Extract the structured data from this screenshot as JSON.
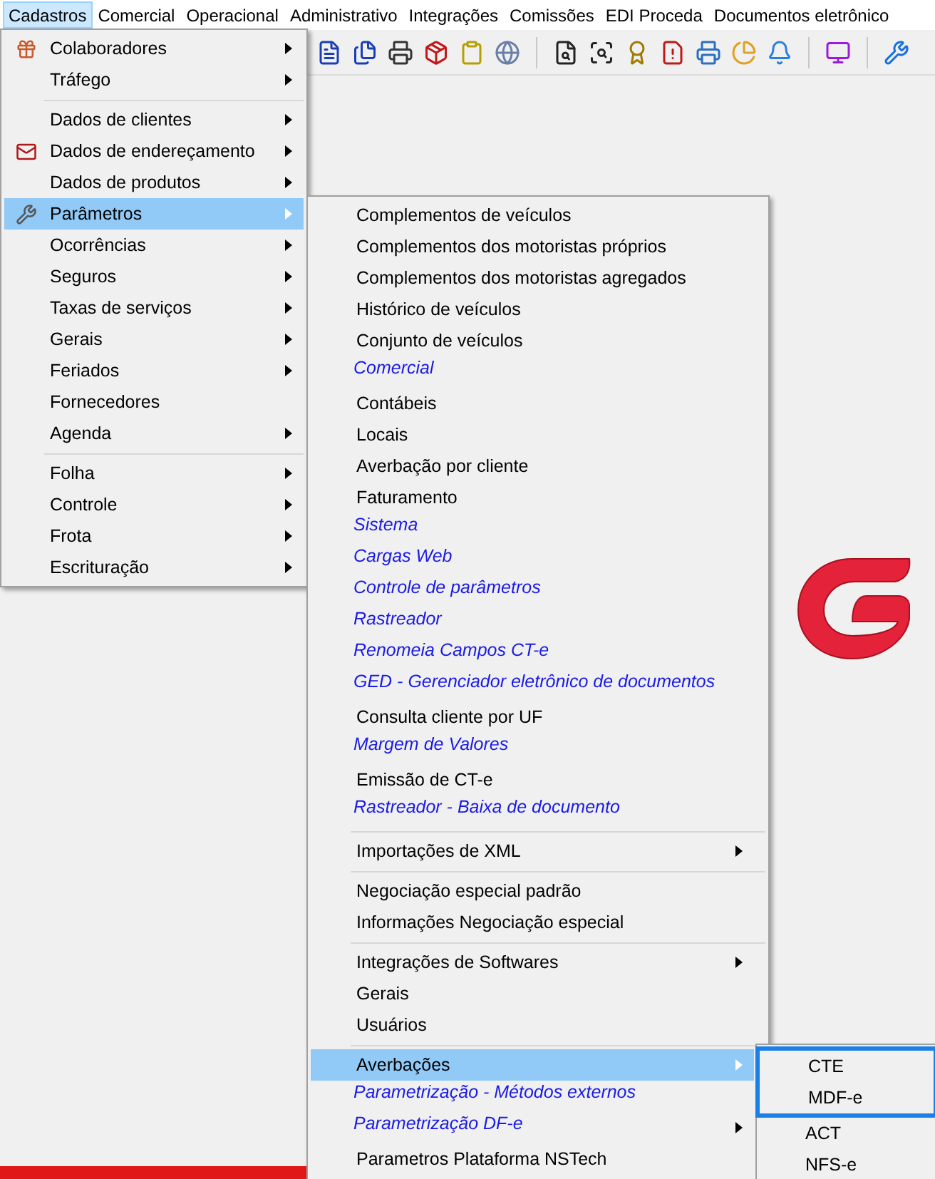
{
  "menubar": [
    {
      "label": "Cadastros",
      "selected": true
    },
    {
      "label": "Comercial",
      "selected": false
    },
    {
      "label": "Operacional",
      "selected": false
    },
    {
      "label": "Administrativo",
      "selected": false
    },
    {
      "label": "Integrações",
      "selected": false
    },
    {
      "label": "Comissões",
      "selected": false
    },
    {
      "label": "EDI Proceda",
      "selected": false
    },
    {
      "label": "Documentos eletrônico",
      "selected": false
    }
  ],
  "menu": {
    "items": [
      {
        "kind": "item",
        "label": "Colaboradores",
        "submenu": true,
        "selected": false
      },
      {
        "kind": "item",
        "label": "Tráfego",
        "submenu": true,
        "selected": false
      },
      {
        "kind": "separator"
      },
      {
        "kind": "item",
        "label": "Dados de clientes",
        "submenu": true,
        "selected": false
      },
      {
        "kind": "item",
        "label": "Dados de endereçamento",
        "submenu": true,
        "selected": false
      },
      {
        "kind": "item",
        "label": "Dados de produtos",
        "submenu": true,
        "selected": false
      },
      {
        "kind": "item",
        "label": "Parâmetros",
        "submenu": true,
        "selected": true
      },
      {
        "kind": "item",
        "label": "Ocorrências",
        "submenu": true,
        "selected": false
      },
      {
        "kind": "item",
        "label": "Seguros",
        "submenu": true,
        "selected": false
      },
      {
        "kind": "item",
        "label": "Taxas de serviços",
        "submenu": true,
        "selected": false
      },
      {
        "kind": "item",
        "label": "Gerais",
        "submenu": true,
        "selected": false
      },
      {
        "kind": "item",
        "label": "Feriados",
        "submenu": true,
        "selected": false
      },
      {
        "kind": "item",
        "label": "Fornecedores",
        "submenu": false,
        "selected": false
      },
      {
        "kind": "item",
        "label": "Agenda",
        "submenu": true,
        "selected": false
      },
      {
        "kind": "separator"
      },
      {
        "kind": "item",
        "label": "Folha",
        "submenu": true,
        "selected": false
      },
      {
        "kind": "item",
        "label": "Controle",
        "submenu": true,
        "selected": false
      },
      {
        "kind": "item",
        "label": "Frota",
        "submenu": true,
        "selected": false
      },
      {
        "kind": "item",
        "label": "Escrituração",
        "submenu": true,
        "selected": false
      }
    ]
  },
  "submenu": {
    "items": [
      {
        "kind": "item",
        "label": "Complementos de veículos",
        "submenu": false,
        "selected": false
      },
      {
        "kind": "item",
        "label": "Complementos dos motoristas próprios",
        "submenu": false,
        "selected": false
      },
      {
        "kind": "item",
        "label": "Complementos dos motoristas agregados",
        "submenu": false,
        "selected": false
      },
      {
        "kind": "item",
        "label": "Histórico de veículos",
        "submenu": false,
        "selected": false
      },
      {
        "kind": "item",
        "label": "Conjunto de veículos",
        "submenu": false,
        "selected": false
      },
      {
        "kind": "link",
        "label": "Comercial",
        "submenu": false,
        "selected": false
      },
      {
        "kind": "item",
        "label": "Contábeis",
        "submenu": false,
        "selected": false
      },
      {
        "kind": "item",
        "label": "Locais",
        "submenu": false,
        "selected": false
      },
      {
        "kind": "item",
        "label": "Averbação por cliente",
        "submenu": false,
        "selected": false
      },
      {
        "kind": "item",
        "label": "Faturamento",
        "submenu": false,
        "selected": false
      },
      {
        "kind": "link",
        "label": "Sistema",
        "submenu": false,
        "selected": false
      },
      {
        "kind": "link",
        "label": "Cargas Web",
        "submenu": false,
        "selected": false
      },
      {
        "kind": "link",
        "label": "Controle de parâmetros",
        "submenu": false,
        "selected": false
      },
      {
        "kind": "link",
        "label": "Rastreador",
        "submenu": false,
        "selected": false
      },
      {
        "kind": "link",
        "label": "Renomeia Campos CT-e",
        "submenu": false,
        "selected": false
      },
      {
        "kind": "link",
        "label": "GED - Gerenciador eletrônico de documentos",
        "submenu": false,
        "selected": false
      },
      {
        "kind": "item",
        "label": "Consulta cliente por UF",
        "submenu": false,
        "selected": false
      },
      {
        "kind": "link",
        "label": "Margem de Valores",
        "submenu": false,
        "selected": false
      },
      {
        "kind": "item",
        "label": "Emissão de CT-e",
        "submenu": false,
        "selected": false
      },
      {
        "kind": "link",
        "label": "Rastreador - Baixa de documento",
        "submenu": false,
        "selected": false
      },
      {
        "kind": "separator"
      },
      {
        "kind": "item",
        "label": "Importações de XML",
        "submenu": true,
        "selected": false
      },
      {
        "kind": "separator"
      },
      {
        "kind": "item",
        "label": "Negociação especial padrão",
        "submenu": false,
        "selected": false
      },
      {
        "kind": "item",
        "label": "Informações Negociação especial",
        "submenu": false,
        "selected": false
      },
      {
        "kind": "separator"
      },
      {
        "kind": "item",
        "label": "Integrações de Softwares",
        "submenu": true,
        "selected": false
      },
      {
        "kind": "item",
        "label": "Gerais",
        "submenu": false,
        "selected": false
      },
      {
        "kind": "item",
        "label": "Usuários",
        "submenu": false,
        "selected": false
      },
      {
        "kind": "separator"
      },
      {
        "kind": "item",
        "label": "Averbações",
        "submenu": true,
        "selected": true
      },
      {
        "kind": "link",
        "label": "Parametrização - Métodos externos",
        "submenu": false,
        "selected": false
      },
      {
        "kind": "link",
        "label": "Parametrização DF-e",
        "submenu": true,
        "selected": false
      },
      {
        "kind": "item",
        "label": "Parametros Plataforma NSTech",
        "submenu": false,
        "selected": false
      }
    ]
  },
  "submenu_2": {
    "items": [
      {
        "label": "CTE",
        "outlined": true,
        "selected": false
      },
      {
        "label": "MDF-e",
        "outlined": true,
        "selected": false
      },
      {
        "label": "ACT",
        "outlined": false,
        "selected": false
      },
      {
        "label": "NFS-e",
        "outlined": false,
        "selected": false
      }
    ]
  }
}
